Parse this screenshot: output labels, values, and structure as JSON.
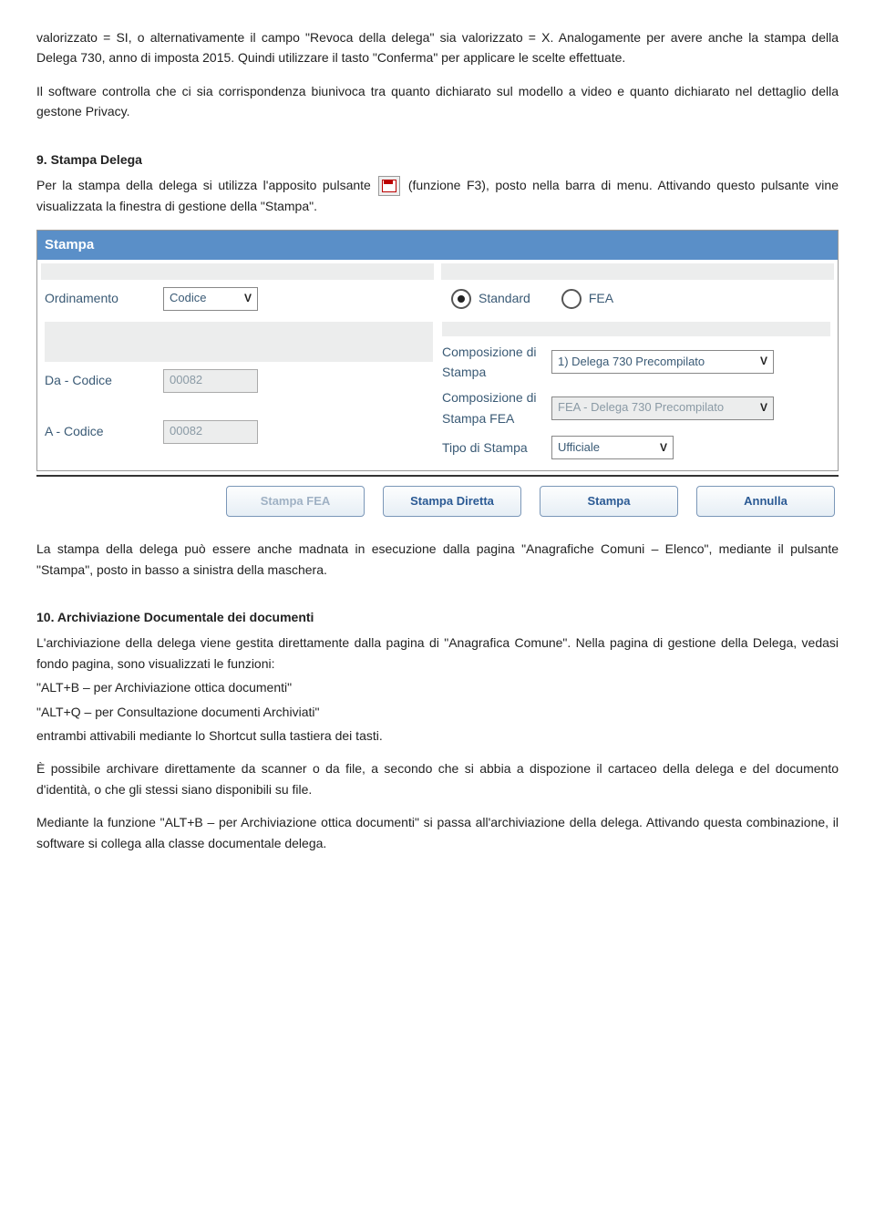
{
  "intro": {
    "p1": "valorizzato = SI, o alternativamente il campo \"Revoca della delega\" sia valorizzato = X. Analogamente per avere anche la stampa della Delega 730, anno di imposta 2015. Quindi utilizzare il tasto \"Conferma\" per applicare le scelte effettuate.",
    "p2": "Il software controlla che ci sia corrispondenza biunivoca tra quanto dichiarato sul modello a video e quanto dichiarato nel dettaglio della gestone Privacy."
  },
  "sec9": {
    "title": "9. Stampa Delega",
    "p1a": "Per la stampa della delega si utilizza l'apposito pulsante ",
    "p1b": " (funzione F3), posto nella barra di menu. Attivando questo pulsante vine visualizzata la finestra di gestione della \"Stampa\"."
  },
  "stampa": {
    "header": "Stampa",
    "left": {
      "ordinamento_label": "Ordinamento",
      "ordinamento_value": "Codice",
      "da_label": "Da - Codice",
      "da_value": "00082",
      "a_label": "A  - Codice",
      "a_value": "00082"
    },
    "right": {
      "radio_standard": "Standard",
      "radio_fea": "FEA",
      "comp_label": "Composizione di Stampa",
      "comp_value": "1) Delega 730 Precompilato",
      "compfea_label": "Composizione di Stampa FEA",
      "compfea_value": "FEA - Delega 730 Precompilato",
      "tipo_label": "Tipo di Stampa",
      "tipo_value": "Ufficiale"
    },
    "buttons": {
      "stampa_fea": "Stampa FEA",
      "stampa_diretta": "Stampa Diretta",
      "stampa": "Stampa",
      "annulla": "Annulla"
    }
  },
  "post_stampa": {
    "p1": "La stampa della delega può essere anche madnata in esecuzione dalla pagina \"Anagrafiche Comuni – Elenco\", mediante il pulsante \"Stampa\", posto in basso a sinistra della maschera."
  },
  "sec10": {
    "title": "10. Archiviazione Documentale dei documenti",
    "p1": "L'archiviazione della delega viene gestita direttamente dalla pagina di \"Anagrafica Comune\". Nella pagina di gestione della Delega, vedasi fondo pagina, sono visualizzati le funzioni:",
    "li1": " \"ALT+B – per Archiviazione ottica documenti\"",
    "li2": "\"ALT+Q – per Consultazione documenti Archiviati\"",
    "p2": "entrambi attivabili mediante lo Shortcut sulla tastiera dei tasti.",
    "p3": "È possibile archivare direttamente da scanner o da file, a secondo che si abbia a dispozione il cartaceo della delega e del documento d'identità, o che gli stessi siano disponibili su file.",
    "p4": "Mediante la funzione \"ALT+B – per Archiviazione ottica documenti\" si passa all'archiviazione della delega. Attivando questa combinazione, il software si collega alla classe documentale delega."
  }
}
